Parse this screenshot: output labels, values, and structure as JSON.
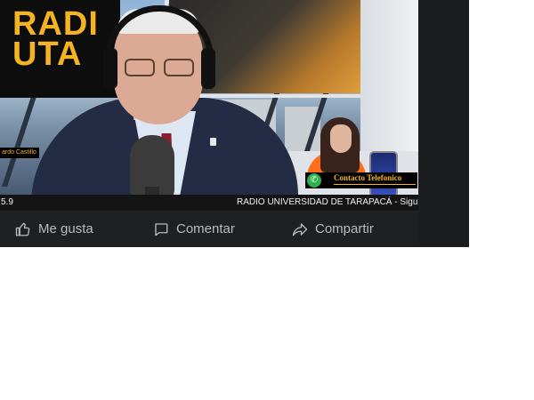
{
  "video": {
    "logo_line1": "RADI",
    "logo_line2": "UTA",
    "name_tag": "ardo Castillo",
    "contact_label": "Contacto Telefonico",
    "ticker_left": "5.9",
    "ticker_right": "RADIO UNIVERSIDAD DE TARAPACÁ - Sigu",
    "brand_color": "#f4b321"
  },
  "actions": [
    {
      "label": "Me gusta",
      "icon": "thumbs-up-icon"
    },
    {
      "label": "Comentar",
      "icon": "comment-icon"
    },
    {
      "label": "Compartir",
      "icon": "share-icon"
    }
  ],
  "colors": {
    "action_bar": "#1f2022",
    "action_text": "#b8bbbf"
  }
}
